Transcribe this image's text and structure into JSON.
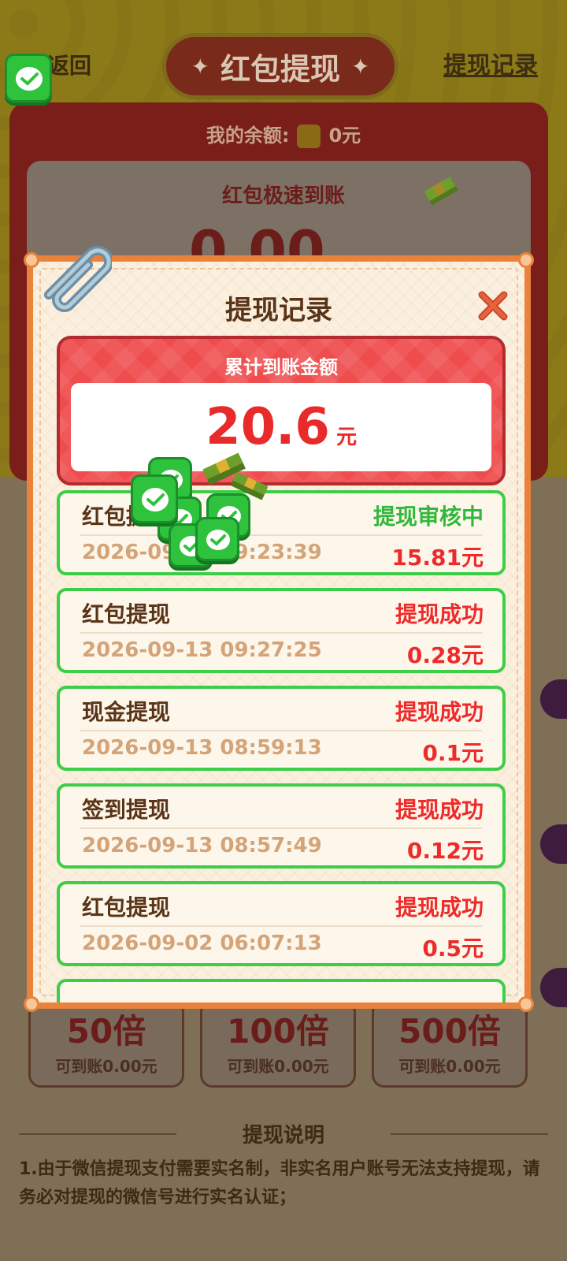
{
  "header": {
    "back_label": "返回",
    "title": "红包提现",
    "record_link": "提现记录"
  },
  "balance": {
    "label": "我的余额:",
    "value": "0元"
  },
  "card": {
    "title": "红包极速到账",
    "amount": "0.00"
  },
  "modal": {
    "title": "提现记录",
    "summary_label": "累计到账金额",
    "summary_amount": "20.6",
    "summary_unit": "元",
    "records": [
      {
        "type": "红包提现",
        "status": "提现审核中",
        "time": "2026-09-13 09:23:39",
        "amount": "15.81元"
      },
      {
        "type": "红包提现",
        "status": "提现成功",
        "time": "2026-09-13 09:27:25",
        "amount": "0.28元"
      },
      {
        "type": "现金提现",
        "status": "提现成功",
        "time": "2026-09-13 08:59:13",
        "amount": "0.1元"
      },
      {
        "type": "签到提现",
        "status": "提现成功",
        "time": "2026-09-13 08:57:49",
        "amount": "0.12元"
      },
      {
        "type": "红包提现",
        "status": "提现成功",
        "time": "2026-09-02 06:07:13",
        "amount": "0.5元"
      }
    ]
  },
  "multipliers": [
    {
      "label": "50倍",
      "sub": "可到账0.00元"
    },
    {
      "label": "100倍",
      "sub": "可到账0.00元"
    },
    {
      "label": "500倍",
      "sub": "可到账0.00元"
    }
  ],
  "description": {
    "title": "提现说明",
    "text": "1.由于微信提现支付需要实名制，非实名用户账号无法支持提现，请务必对提现的微信号进行实名认证；"
  },
  "colors": {
    "accent_red": "#ee2b2b",
    "pending_green": "#32b83c",
    "modal_border": "#e9823a",
    "wechat_green": "#2fc23d"
  },
  "icons": [
    "wechat-icon",
    "money-stack-icon",
    "paperclip-icon",
    "close-icon",
    "coin-icon"
  ]
}
